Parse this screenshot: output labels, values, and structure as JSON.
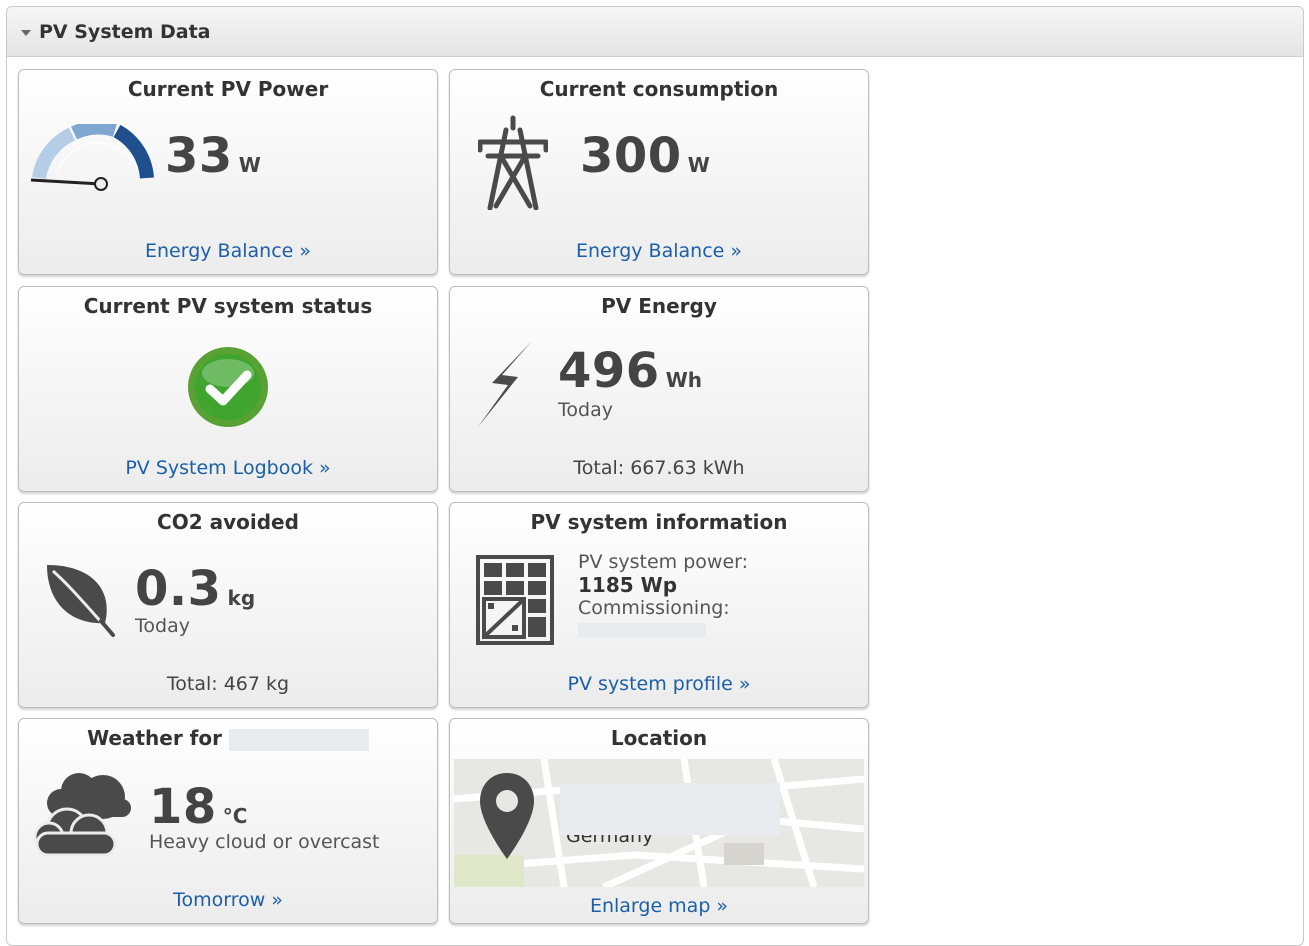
{
  "panel": {
    "title": "PV System Data"
  },
  "tiles": {
    "pv_power": {
      "title": "Current PV Power",
      "value": "33",
      "unit": "W",
      "link": "Energy Balance »"
    },
    "consumption": {
      "title": "Current consumption",
      "value": "300",
      "unit": "W",
      "link": "Energy Balance »"
    },
    "status": {
      "title": "Current PV system status",
      "link": "PV System Logbook »"
    },
    "energy": {
      "title": "PV Energy",
      "value": "496",
      "unit": "Wh",
      "period": "Today",
      "total": "Total: 667.63 kWh"
    },
    "co2": {
      "title": "CO2 avoided",
      "value": "0.3",
      "unit": "kg",
      "period": "Today",
      "total": "Total: 467 kg"
    },
    "info": {
      "title": "PV system information",
      "power_label": "PV system power:",
      "power_value": "1185 Wp",
      "commissioning_label": "Commissioning:",
      "link": "PV system profile »"
    },
    "weather": {
      "title": "Weather for",
      "value": "18",
      "unit": "°C",
      "condition": "Heavy cloud or overcast",
      "link": "Tomorrow »"
    },
    "location": {
      "title": "Location",
      "address_fragment": "Germany",
      "link": "Enlarge map »"
    }
  },
  "colors": {
    "link": "#1c5fa8",
    "status_ok": "#3fa52f",
    "icon": "#4a4a4a"
  },
  "icons": [
    "speedometer-icon",
    "power-tower-icon",
    "checkmark-icon",
    "lightning-icon",
    "leaf-icon",
    "solar-panel-icon",
    "cloud-icon",
    "map-pin-icon"
  ]
}
